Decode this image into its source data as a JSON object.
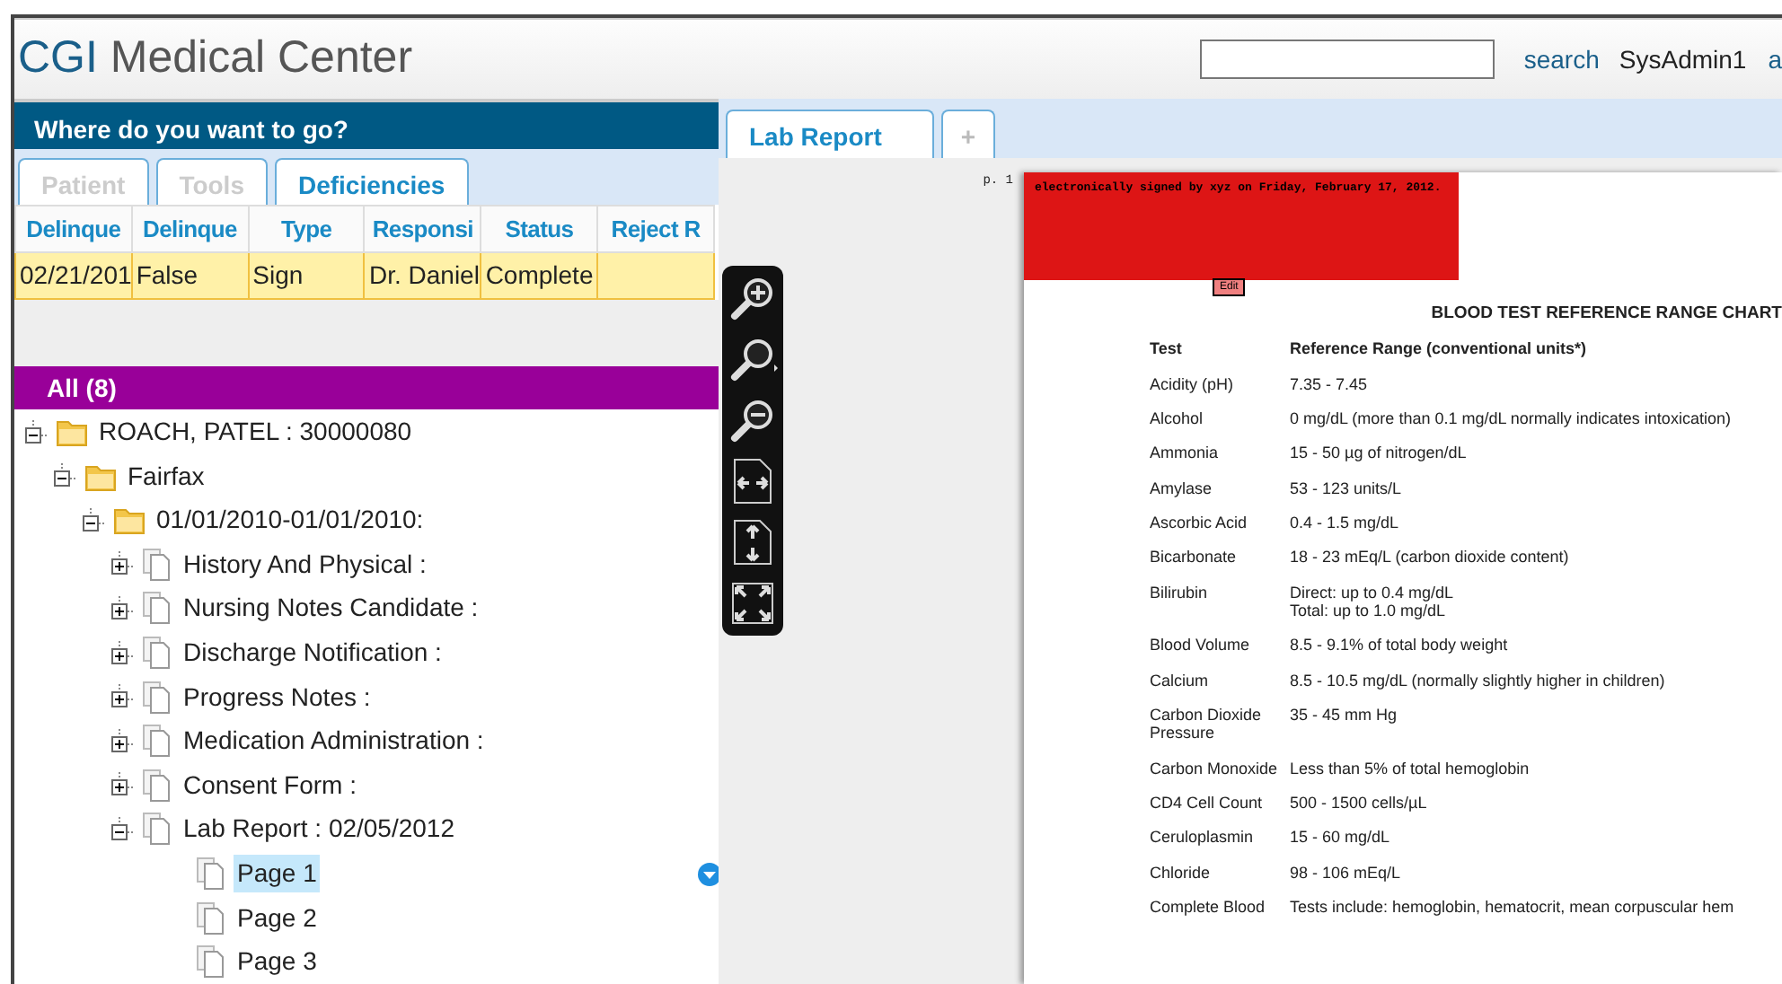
{
  "header": {
    "title_brand": "CGI",
    "title_rest": "Medical Center",
    "search_link": "search",
    "user": "SysAdmin1",
    "cut_link": "a"
  },
  "nav_bar": {
    "title": "Where do you want to go?"
  },
  "left_tabs": [
    {
      "label": "Patient",
      "selected": false
    },
    {
      "label": "Tools",
      "selected": false
    },
    {
      "label": "Deficiencies",
      "selected": true
    }
  ],
  "deficiency_table": {
    "columns": [
      "Delinque",
      "Delinque",
      "Type",
      "Responsi",
      "Status",
      "Reject R"
    ],
    "rows": [
      {
        "selected": true,
        "cells": [
          "02/21/201",
          "False",
          "Sign",
          "Dr. Daniel",
          "Complete",
          ""
        ]
      }
    ]
  },
  "tree_header": {
    "title": "All (8)"
  },
  "tree": [
    {
      "label": "ROACH, PATEL : 30000080",
      "kind": "folder",
      "expanded": true,
      "selected": false,
      "children": [
        {
          "label": "Fairfax",
          "kind": "folder",
          "expanded": true,
          "selected": false,
          "children": [
            {
              "label": "01/01/2010-01/01/2010:",
              "kind": "folder",
              "expanded": true,
              "selected": false,
              "children": [
                {
                  "label": "History And Physical :",
                  "kind": "document",
                  "expanded": false,
                  "selected": false
                },
                {
                  "label": "Nursing Notes Candidate :",
                  "kind": "document",
                  "expanded": false,
                  "selected": false
                },
                {
                  "label": "Discharge Notification :",
                  "kind": "document",
                  "expanded": false,
                  "selected": false
                },
                {
                  "label": "Progress Notes :",
                  "kind": "document",
                  "expanded": false,
                  "selected": false
                },
                {
                  "label": "Medication Administration :",
                  "kind": "document",
                  "expanded": false,
                  "selected": false
                },
                {
                  "label": "Consent Form :",
                  "kind": "document",
                  "expanded": false,
                  "selected": false
                },
                {
                  "label": "Lab Report : 02/05/2012",
                  "kind": "document",
                  "expanded": true,
                  "selected": false,
                  "children": [
                    {
                      "label": "Page 1",
                      "kind": "page",
                      "selected": true
                    },
                    {
                      "label": "Page 2",
                      "kind": "page",
                      "selected": false
                    },
                    {
                      "label": "Page 3",
                      "kind": "page",
                      "selected": false
                    }
                  ]
                }
              ]
            }
          ]
        }
      ]
    }
  ],
  "viewer_tabs": [
    {
      "label": "Lab Report",
      "selected": true
    },
    {
      "label": "+",
      "selected": false
    }
  ],
  "viewer": {
    "page_label": "p. 1",
    "signature": "electronically signed by xyz on Friday, February 17, 2012.",
    "edit_button": "Edit",
    "document_title": "BLOOD TEST REFERENCE RANGE CHART",
    "column_headers": [
      "Test",
      "Reference Range (conventional units*)"
    ],
    "rows": [
      [
        "Acidity (pH)",
        "7.35 - 7.45"
      ],
      [
        "Alcohol",
        "0 mg/dL (more than 0.1 mg/dL normally indicates intoxication)"
      ],
      [
        "Ammonia",
        "15 - 50 µg of nitrogen/dL"
      ],
      [
        "Amylase",
        "53 - 123 units/L"
      ],
      [
        "Ascorbic Acid",
        "0.4 - 1.5 mg/dL"
      ],
      [
        "Bicarbonate",
        "18 - 23 mEq/L (carbon dioxide content)"
      ],
      [
        "Bilirubin",
        "Direct: up to 0.4 mg/dL\nTotal: up to 1.0 mg/dL"
      ],
      [
        "Blood Volume",
        "8.5 - 9.1% of total body weight"
      ],
      [
        "Calcium",
        "8.5 - 10.5 mg/dL (normally slightly higher in children)"
      ],
      [
        "Carbon Dioxide Pressure",
        "35 - 45 mm Hg"
      ],
      [
        "Carbon Monoxide",
        "Less than 5% of total hemoglobin"
      ],
      [
        "CD4 Cell Count",
        "500 - 1500 cells/µL"
      ],
      [
        "Ceruloplasmin",
        "15 - 60 mg/dL"
      ],
      [
        "Chloride",
        "98 - 106 mEq/L"
      ],
      [
        "Complete Blood",
        "Tests include: hemoglobin, hematocrit, mean corpuscular hem"
      ]
    ]
  }
}
